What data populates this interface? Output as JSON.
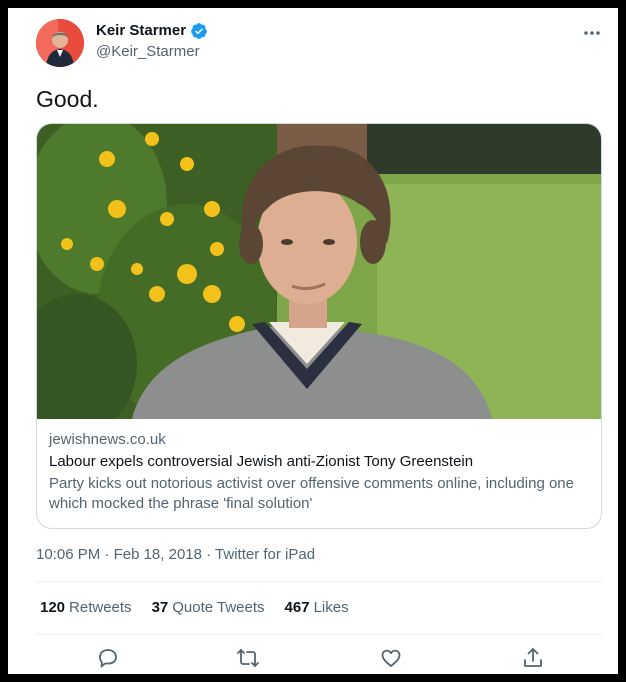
{
  "author": {
    "name": "Keir Starmer",
    "handle": "@Keir_Starmer",
    "verified_icon": "verified-badge-icon"
  },
  "tweet": {
    "text": "Good."
  },
  "link_card": {
    "domain": "jewishnews.co.uk",
    "title": "Labour expels controversial Jewish anti-Zionist Tony Greenstein",
    "description": "Party kicks out notorious activist over offensive comments online, including one which mocked the phrase 'final solution'"
  },
  "meta": {
    "time": "10:06 PM",
    "date": "Feb 18, 2018",
    "source": "Twitter for iPad"
  },
  "stats": {
    "retweets_count": "120",
    "retweets_label": "Retweets",
    "quotes_count": "37",
    "quotes_label": "Quote Tweets",
    "likes_count": "467",
    "likes_label": "Likes"
  },
  "colors": {
    "accent": "#1d9bf0",
    "text_primary": "#0f1419",
    "text_secondary": "#536471",
    "border": "#cfd9de"
  },
  "icons": [
    "more-icon",
    "verified-badge-icon",
    "reply-icon",
    "retweet-icon",
    "like-icon",
    "share-icon"
  ]
}
